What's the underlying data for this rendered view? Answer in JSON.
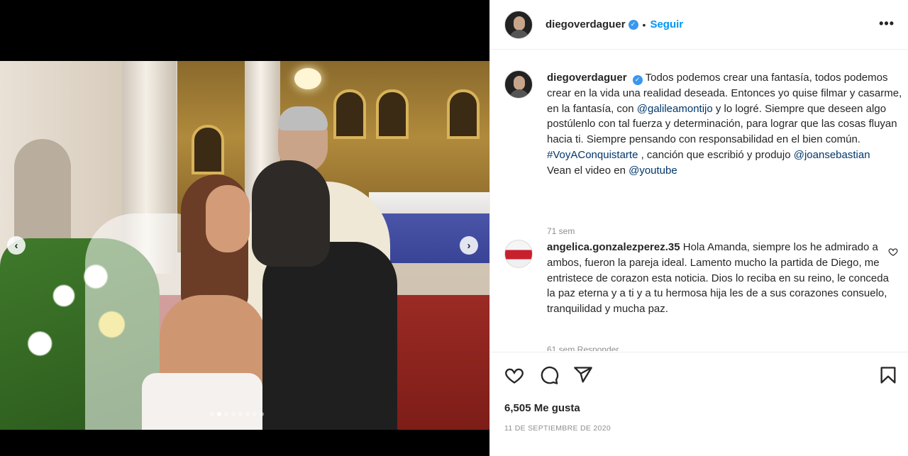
{
  "post": {
    "username": "diegoverdaguer",
    "verified_badge": "✓",
    "separator": "•",
    "follow_label": "Seguir",
    "more_label": "•••",
    "caption": {
      "text_1": "Todos podemos crear una fantasía, todos podemos crear en la vida una realidad deseada. Entonces yo quise filmar y casarme, en la fantasía, con ",
      "mention_1": "@galileamontijo",
      "text_2": " y lo logré. Siempre que deseen algo postúlenlo con tal fuerza y determinación, para lograr que las cosas fluyan hacia ti. Siempre pensando con responsabilidad en el bien común.",
      "hashtag": "#VoyAConquistarte",
      "text_3": ", canción que escribió y produjo ",
      "mention_2": "@joansebastian",
      "text_4": "Vean el video en ",
      "mention_3": "@youtube"
    },
    "caption_time": "71 sem",
    "likes": "6,505 Me gusta",
    "date": "11 DE SEPTIEMBRE DE 2020"
  },
  "comment": {
    "username": "angelica.gonzalezperez.35",
    "text": "Hola Amanda, siempre los he admirado a ambos, fueron la pareja ideal. Lamento mucho la partida de Diego, me entristece de corazon esta noticia. Dios lo reciba en su reino, le conceda la paz eterna y a ti y a tu hermosa hija les de a sus corazones consuelo, tranquilidad y mucha paz.",
    "meta": "61 sem  Responder"
  },
  "carousel": {
    "prev_glyph": "‹",
    "next_glyph": "›",
    "total": 8,
    "active_index": 1
  },
  "icons": [
    "heart-icon",
    "comment-icon",
    "share-icon",
    "bookmark-icon"
  ],
  "colors": {
    "link": "#00376b",
    "follow": "#0095f6",
    "verified": "#3897f0",
    "muted": "#8e8e8e"
  }
}
